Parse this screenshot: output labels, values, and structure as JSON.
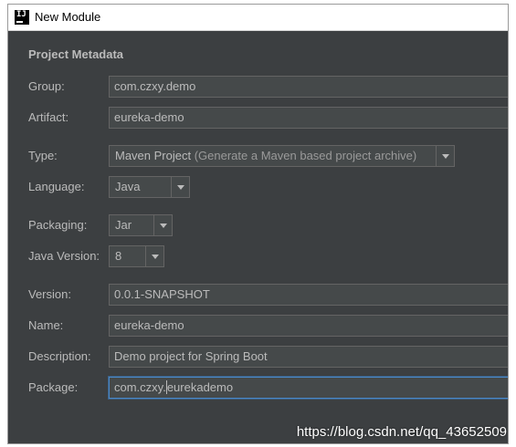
{
  "window": {
    "title": "New Module",
    "app_icon_text": "IJ"
  },
  "section": {
    "title": "Project Metadata"
  },
  "fields": {
    "group": {
      "label": "Group:",
      "value": "com.czxy.demo"
    },
    "artifact": {
      "label": "Artifact:",
      "value": "eureka-demo"
    },
    "type": {
      "label": "Type:",
      "value": "Maven Project",
      "hint": "(Generate a Maven based project archive)"
    },
    "language": {
      "label": "Language:",
      "value": "Java"
    },
    "packaging": {
      "label": "Packaging:",
      "value": "Jar"
    },
    "java_version": {
      "label": "Java Version:",
      "value": "8"
    },
    "version": {
      "label": "Version:",
      "value": "0.0.1-SNAPSHOT"
    },
    "name": {
      "label": "Name:",
      "value": "eureka-demo"
    },
    "description": {
      "label": "Description:",
      "value": "Demo project for Spring Boot"
    },
    "package": {
      "label": "Package:",
      "value_before_caret": "com.czxy.",
      "value_after_caret": "eurekademo"
    }
  },
  "icons": {
    "app": "intellij-icon",
    "dropdown": "chevron-down-icon"
  },
  "colors": {
    "background": "#3c3f41",
    "field_bg": "#45494a",
    "field_border": "#646464",
    "focus_border": "#4a88c7",
    "text": "#bbbbbb"
  },
  "watermark": "https://blog.csdn.net/qq_43652509"
}
